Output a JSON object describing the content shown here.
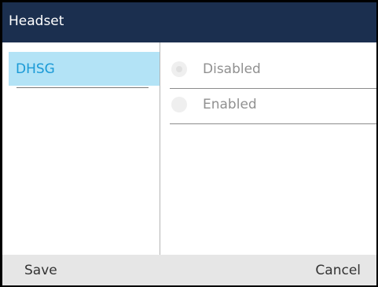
{
  "title": "Headset",
  "left_menu": {
    "items": [
      {
        "label": "DHSG",
        "selected": true
      }
    ]
  },
  "options": {
    "disabled_label": "Disabled",
    "enabled_label": "Enabled",
    "selected": "Disabled"
  },
  "softkeys": {
    "save_label": "Save",
    "cancel_label": "Cancel"
  },
  "colors": {
    "title_bar": "#1b2f4f",
    "selected_item_bg": "#b3e3f6",
    "selected_item_text": "#1a9ad6",
    "softkey_bar": "#e6e6e6",
    "disabled_text": "#909090"
  }
}
